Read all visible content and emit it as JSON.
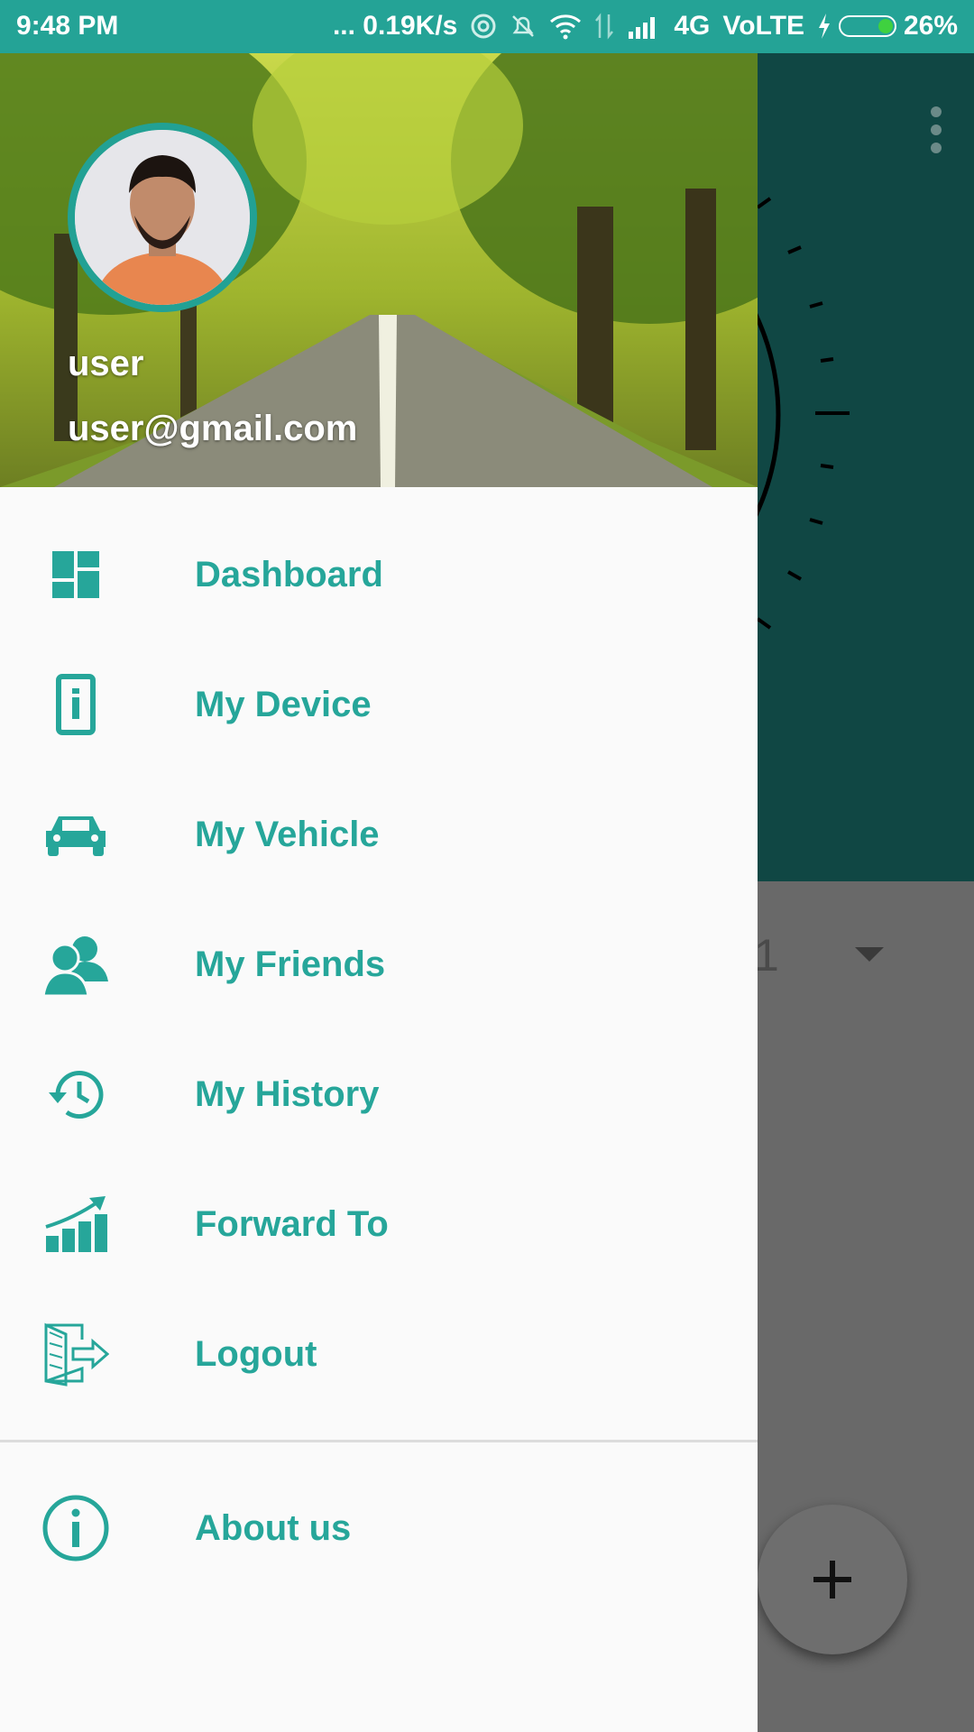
{
  "status_bar": {
    "time": "9:48 PM",
    "speed": "... 0.19K/s",
    "network": "4G",
    "volte": "VoLTE",
    "battery": "26%"
  },
  "drawer": {
    "user_name": "user",
    "user_email": "user@gmail.com",
    "menu": [
      {
        "label": "Dashboard",
        "icon": "dashboard-icon"
      },
      {
        "label": "My Device",
        "icon": "device-icon"
      },
      {
        "label": "My Vehicle",
        "icon": "car-icon"
      },
      {
        "label": "My Friends",
        "icon": "friends-icon"
      },
      {
        "label": "My History",
        "icon": "history-icon"
      },
      {
        "label": "Forward To",
        "icon": "bar-chart-icon"
      },
      {
        "label": "Logout",
        "icon": "logout-icon"
      }
    ],
    "secondary": {
      "label": "About us",
      "icon": "info-icon"
    }
  },
  "background": {
    "partial_value": "1"
  },
  "colors": {
    "accent": "#26a69a",
    "status_bar": "#24a396",
    "app_top": "#104744"
  }
}
